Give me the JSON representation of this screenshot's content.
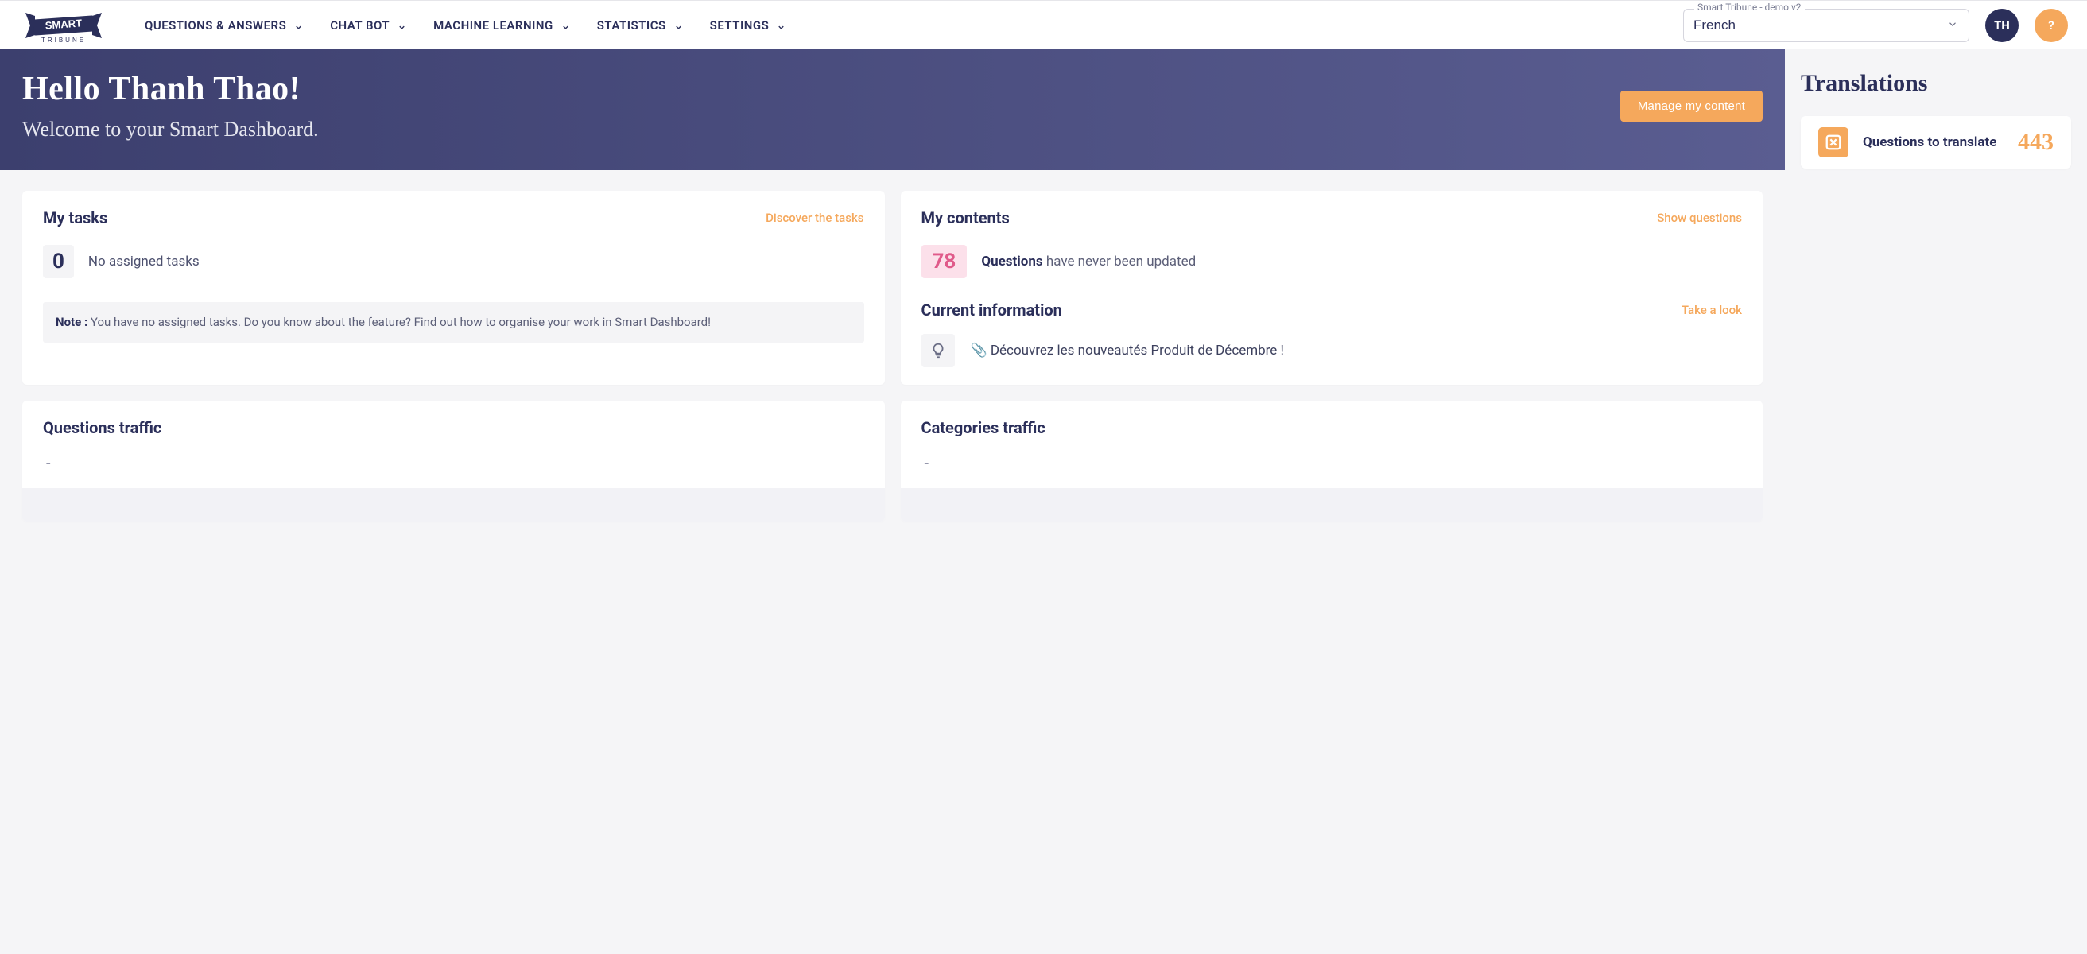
{
  "nav": {
    "items": [
      {
        "label": "QUESTIONS & ANSWERS"
      },
      {
        "label": "CHAT BOT"
      },
      {
        "label": "MACHINE LEARNING"
      },
      {
        "label": "STATISTICS"
      },
      {
        "label": "SETTINGS"
      }
    ],
    "instance_label": "Smart Tribune - demo v2",
    "language": "French",
    "user_initials": "TH",
    "help_label": "?"
  },
  "hero": {
    "greeting": "Hello Thanh Thao!",
    "subtitle": "Welcome to your Smart Dashboard.",
    "button": "Manage my content"
  },
  "tasks": {
    "title": "My tasks",
    "link": "Discover the tasks",
    "count": "0",
    "count_label": "No assigned tasks",
    "note_prefix": "Note :",
    "note_body": "You have no assigned tasks. Do you know about the feature? Find out how to organise your work in Smart Dashboard!"
  },
  "contents": {
    "title": "My contents",
    "link": "Show questions",
    "count": "78",
    "q_bold": "Questions",
    "q_rest": "have never been updated"
  },
  "current_info": {
    "title": "Current information",
    "link": "Take a look",
    "text": "📎 Découvrez les nouveautés Produit de Décembre !"
  },
  "questions_traffic": {
    "title": "Questions traffic",
    "value": "-"
  },
  "categories_traffic": {
    "title": "Categories traffic",
    "value": "-"
  },
  "translations": {
    "title": "Translations",
    "label": "Questions to translate",
    "count": "443"
  },
  "logo": {
    "top": "SMART",
    "bottom": "TRIBUNE"
  }
}
